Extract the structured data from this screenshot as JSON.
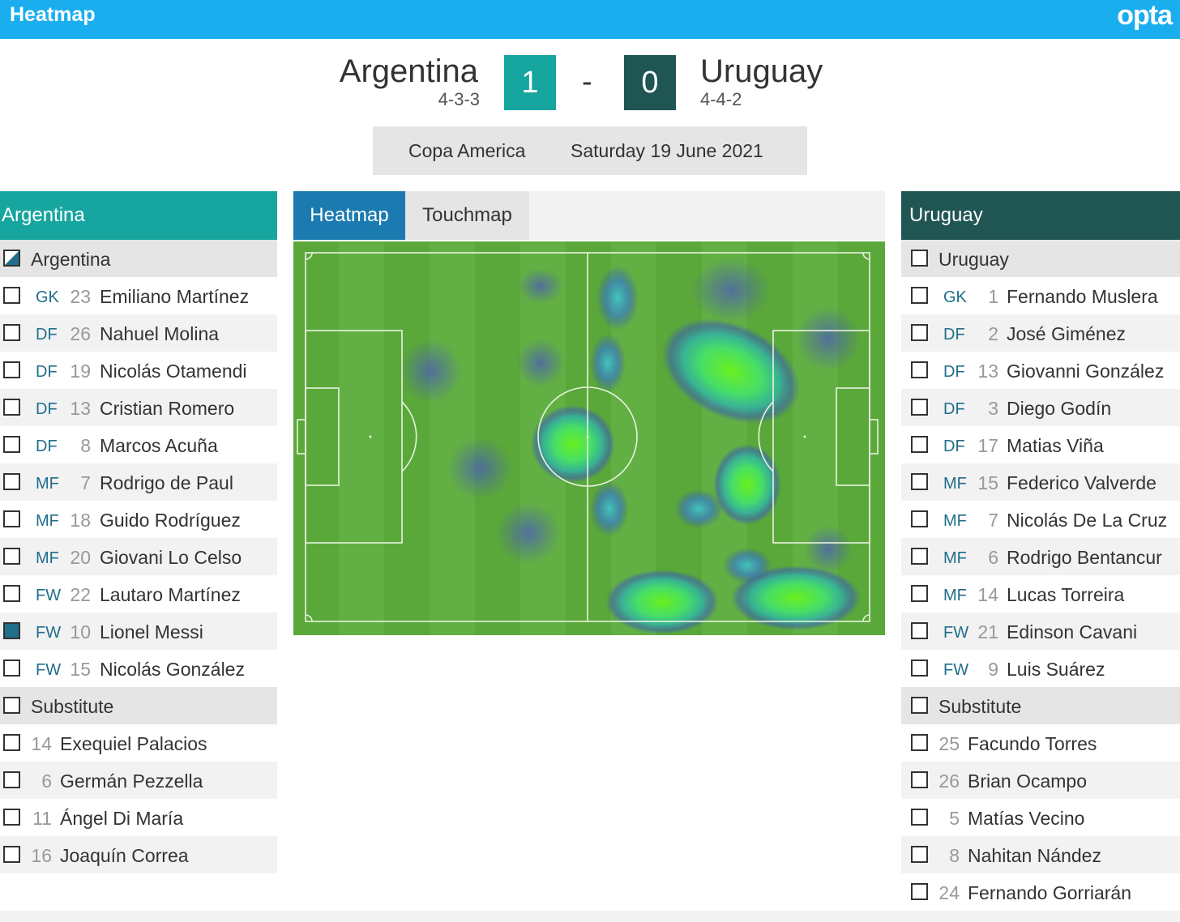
{
  "header": {
    "title": "Heatmap",
    "logo": "opta"
  },
  "match": {
    "home": {
      "name": "Argentina",
      "formation": "4-3-3",
      "score": "1",
      "color": "#17a59f"
    },
    "away": {
      "name": "Uruguay",
      "formation": "4-4-2",
      "score": "0",
      "color": "#1f5553"
    },
    "separator": "-",
    "competition": "Copa America",
    "date": "Saturday 19 June 2021"
  },
  "tabs": [
    {
      "label": "Heatmap",
      "active": true
    },
    {
      "label": "Touchmap",
      "active": false
    }
  ],
  "home_panel": {
    "title": "Argentina",
    "team_row": {
      "label": "Argentina",
      "state": "partial"
    },
    "starters": [
      {
        "pos": "GK",
        "num": "23",
        "name": "Emiliano Martínez",
        "checked": false
      },
      {
        "pos": "DF",
        "num": "26",
        "name": "Nahuel Molina",
        "checked": false
      },
      {
        "pos": "DF",
        "num": "19",
        "name": "Nicolás Otamendi",
        "checked": false
      },
      {
        "pos": "DF",
        "num": "13",
        "name": "Cristian Romero",
        "checked": false
      },
      {
        "pos": "DF",
        "num": "8",
        "name": "Marcos Acuña",
        "checked": false
      },
      {
        "pos": "MF",
        "num": "7",
        "name": "Rodrigo de Paul",
        "checked": false
      },
      {
        "pos": "MF",
        "num": "18",
        "name": "Guido Rodríguez",
        "checked": false
      },
      {
        "pos": "MF",
        "num": "20",
        "name": "Giovani Lo Celso",
        "checked": false
      },
      {
        "pos": "FW",
        "num": "22",
        "name": "Lautaro Martínez",
        "checked": false
      },
      {
        "pos": "FW",
        "num": "10",
        "name": "Lionel Messi",
        "checked": true
      },
      {
        "pos": "FW",
        "num": "15",
        "name": "Nicolás González",
        "checked": false
      }
    ],
    "subs_label": "Substitute",
    "subs": [
      {
        "num": "14",
        "name": "Exequiel Palacios"
      },
      {
        "num": "6",
        "name": "Germán Pezzella"
      },
      {
        "num": "11",
        "name": "Ángel Di María"
      },
      {
        "num": "16",
        "name": "Joaquín Correa"
      }
    ]
  },
  "away_panel": {
    "title": "Uruguay",
    "team_row": {
      "label": "Uruguay",
      "state": "unchecked"
    },
    "starters": [
      {
        "pos": "GK",
        "num": "1",
        "name": "Fernando Muslera",
        "checked": false
      },
      {
        "pos": "DF",
        "num": "2",
        "name": "José Giménez",
        "checked": false
      },
      {
        "pos": "DF",
        "num": "13",
        "name": "Giovanni González",
        "checked": false
      },
      {
        "pos": "DF",
        "num": "3",
        "name": "Diego Godín",
        "checked": false
      },
      {
        "pos": "DF",
        "num": "17",
        "name": "Matias Viña",
        "checked": false
      },
      {
        "pos": "MF",
        "num": "15",
        "name": "Federico Valverde",
        "checked": false
      },
      {
        "pos": "MF",
        "num": "7",
        "name": "Nicolás De La Cruz",
        "checked": false
      },
      {
        "pos": "MF",
        "num": "6",
        "name": "Rodrigo Bentancur",
        "checked": false
      },
      {
        "pos": "MF",
        "num": "14",
        "name": "Lucas Torreira",
        "checked": false
      },
      {
        "pos": "FW",
        "num": "21",
        "name": "Edinson Cavani",
        "checked": false
      },
      {
        "pos": "FW",
        "num": "9",
        "name": "Luis Suárez",
        "checked": false
      }
    ],
    "subs_label": "Substitute",
    "subs": [
      {
        "num": "25",
        "name": "Facundo Torres"
      },
      {
        "num": "26",
        "name": "Brian Ocampo"
      },
      {
        "num": "5",
        "name": "Matías Vecino"
      },
      {
        "num": "8",
        "name": "Nahitan Nández"
      },
      {
        "num": "24",
        "name": "Fernando Gorriarán"
      }
    ]
  }
}
